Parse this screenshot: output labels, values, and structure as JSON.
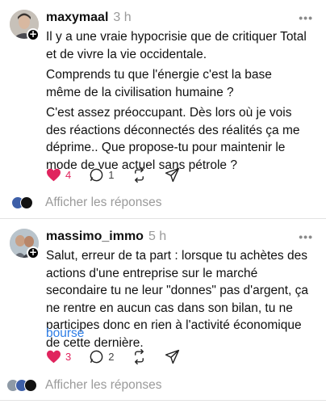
{
  "post1": {
    "username": "maxymaal",
    "time": "3 h",
    "more": "•••",
    "paragraphs": [
      "Il y a une vraie hypocrisie que de critiquer Total et de vivre la vie occidentale.",
      "Comprends tu que l'énergie c'est la base même de la civilisation humaine ?",
      "C'est assez préoccupant. Dès lors où je vois des réactions déconnectés des réalités ça me déprime.. Que propose-tu pour maintenir le mode de vue actuel sans pétrole ?"
    ],
    "likes": "4",
    "comments": "1",
    "liked": true
  },
  "replies1": {
    "label": "Afficher les réponses"
  },
  "post2": {
    "username": "massimo_immo",
    "time": "5 h",
    "more": "•••",
    "paragraphs": [
      "Salut, erreur de ta part : lorsque tu achètes des actions d'une entreprise sur le marché secondaire tu ne leur \"donnes\" pas d'argent, ça ne rentre en aucun cas dans son bilan, tu ne participes donc en rien à l'activité économique de cette dernière."
    ],
    "tag": "bourse",
    "likes": "3",
    "comments": "2",
    "liked": true
  },
  "replies2": {
    "label": "Afficher les réponses"
  },
  "colors": {
    "like_red": "#e0245e",
    "link_blue": "#2f7ee6",
    "muted_gray": "#9a9a9a"
  },
  "icons": [
    "heart-icon",
    "comment-icon",
    "repost-icon",
    "share-icon",
    "more-icon",
    "follow-plus-icon"
  ]
}
